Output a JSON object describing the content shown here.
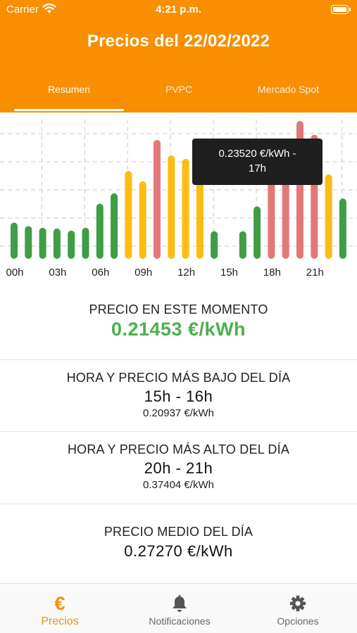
{
  "status_bar": {
    "carrier": "Carrier",
    "time": "4:21 p.m."
  },
  "header": {
    "title": "Precios del 22/02/2022"
  },
  "tabs": [
    {
      "label": "Resumen",
      "selected": true
    },
    {
      "label": "PVPC",
      "selected": false
    },
    {
      "label": "Mercado Spot",
      "selected": false
    }
  ],
  "colors": {
    "brand": "#f78f00",
    "green": "#3f9d46",
    "yellow": "#fcbd10",
    "red": "#e3787a"
  },
  "chart_data": {
    "type": "bar",
    "categories": [
      "00h",
      "01h",
      "02h",
      "03h",
      "04h",
      "05h",
      "06h",
      "07h",
      "08h",
      "09h",
      "10h",
      "11h",
      "12h",
      "13h",
      "14h",
      "15h",
      "16h",
      "17h",
      "18h",
      "19h",
      "20h",
      "21h",
      "22h",
      "23h"
    ],
    "values": [
      0.2505,
      0.2495,
      0.249,
      0.2488,
      0.2482,
      0.249,
      0.256,
      0.259,
      0.2655,
      0.2625,
      0.2745,
      0.27,
      0.269,
      0.265,
      0.248,
      0.2094,
      0.248,
      0.2552,
      0.27,
      0.274,
      0.374,
      0.276,
      0.2645,
      0.2575
    ],
    "levels": [
      "green",
      "green",
      "green",
      "green",
      "green",
      "green",
      "green",
      "green",
      "yellow",
      "yellow",
      "red",
      "yellow",
      "yellow",
      "yellow",
      "green",
      "green",
      "green",
      "green",
      "red",
      "red",
      "red",
      "red",
      "yellow",
      "green"
    ],
    "xtick_labels": [
      "00h",
      "03h",
      "06h",
      "09h",
      "12h",
      "15h",
      "18h",
      "21h"
    ],
    "ylim": [
      0.24,
      0.28
    ],
    "grid": true,
    "tooltip": {
      "line1": "0.23520 €/kWh -",
      "line2": "17h"
    }
  },
  "current": {
    "label": "PRECIO EN ESTE MOMENTO",
    "value": "0.21453 €/kWh"
  },
  "lowest": {
    "label": "HORA Y PRECIO MÁS BAJO DEL DÍA",
    "hours": "15h - 16h",
    "price": "0.20937 €/kWh"
  },
  "highest": {
    "label": "HORA Y PRECIO MÁS ALTO DEL DÍA",
    "hours": "20h - 21h",
    "price": "0.37404 €/kWh"
  },
  "average": {
    "label": "PRECIO MEDIO DEL DÍA",
    "value": "0.27270 €/kWh"
  },
  "tabbar": [
    {
      "label": "Precios",
      "icon": "euro-icon",
      "selected": true
    },
    {
      "label": "Notificaciones",
      "icon": "bell-icon",
      "selected": false
    },
    {
      "label": "Opciones",
      "icon": "gear-icon",
      "selected": false
    }
  ]
}
